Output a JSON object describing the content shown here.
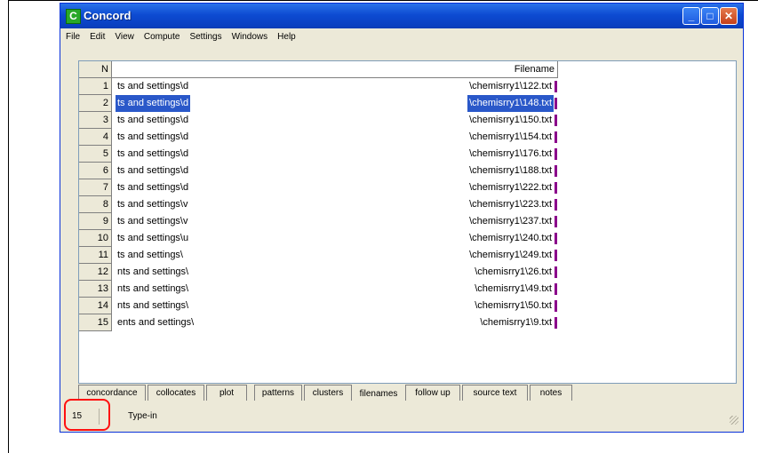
{
  "window": {
    "title": "Concord",
    "app_icon_letter": "C",
    "title_bar_color": "#0d4bd2"
  },
  "menu": [
    "File",
    "Edit",
    "View",
    "Compute",
    "Settings",
    "Windows",
    "Help"
  ],
  "table": {
    "headers": {
      "n": "N",
      "filename": "Filename"
    },
    "rows": [
      {
        "n": "1",
        "path": "ts and settings\\d",
        "file": "\\chemisrry1\\122.txt"
      },
      {
        "n": "2",
        "path": "ts and settings\\d",
        "file": "\\chemisrry1\\148.txt",
        "selected": true
      },
      {
        "n": "3",
        "path": "ts and settings\\d",
        "file": "\\chemisrry1\\150.txt"
      },
      {
        "n": "4",
        "path": "ts and settings\\d",
        "file": "\\chemisrry1\\154.txt"
      },
      {
        "n": "5",
        "path": "ts and settings\\d",
        "file": "\\chemisrry1\\176.txt"
      },
      {
        "n": "6",
        "path": "ts and settings\\d",
        "file": "\\chemisrry1\\188.txt"
      },
      {
        "n": "7",
        "path": "ts and settings\\d",
        "file": "\\chemisrry1\\222.txt"
      },
      {
        "n": "8",
        "path": "ts and settings\\v",
        "file": "\\chemisrry1\\223.txt"
      },
      {
        "n": "9",
        "path": "ts and settings\\v",
        "file": "\\chemisrry1\\237.txt"
      },
      {
        "n": "10",
        "path": "ts and settings\\u",
        "file": "\\chemisrry1\\240.txt"
      },
      {
        "n": "11",
        "path": "ts and settings\\",
        "file": "\\chemisrry1\\249.txt"
      },
      {
        "n": "12",
        "path": "nts and settings\\",
        "file": "\\chemisrry1\\26.txt"
      },
      {
        "n": "13",
        "path": "nts and settings\\",
        "file": "\\chemisrry1\\49.txt"
      },
      {
        "n": "14",
        "path": "nts and settings\\",
        "file": "\\chemisrry1\\50.txt"
      },
      {
        "n": "15",
        "path": "ents and settings\\",
        "file": "\\chemisrry1\\9.txt"
      }
    ]
  },
  "tabs": [
    "concordance",
    "collocates",
    "plot",
    "patterns",
    "clusters",
    "filenames",
    "follow up",
    "source text",
    "notes"
  ],
  "active_tab": "filenames",
  "status": {
    "count": "15",
    "mode": "Type-in"
  },
  "colors": {
    "selection": "#2a58c9",
    "highlight_circle": "#ff1010",
    "end_marker": "#8b008b"
  }
}
